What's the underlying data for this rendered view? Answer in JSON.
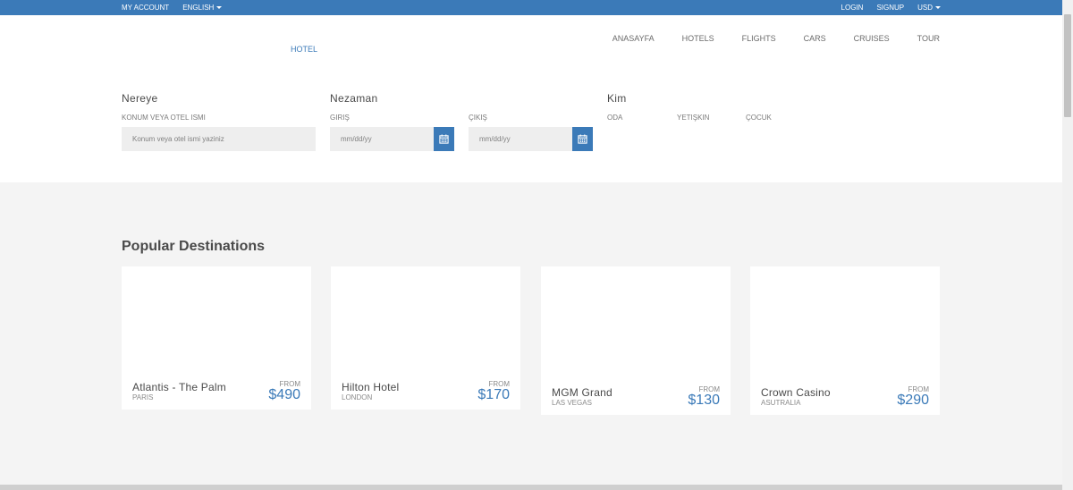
{
  "topbar": {
    "my_account": "MY ACCOUNT",
    "language": "ENGLISH",
    "login": "LOGIN",
    "signup": "SIGNUP",
    "currency": "USD"
  },
  "header": {
    "hotel_tab": "HOTEL",
    "nav": [
      "ANASAYFA",
      "HOTELS",
      "FLIGHTS",
      "CARS",
      "CRUISES",
      "TOUR"
    ]
  },
  "search": {
    "where": {
      "title": "Nereye",
      "label": "KONUM VEYA OTEL ISMI",
      "placeholder": "Konum veya otel ismi yaziniz"
    },
    "when": {
      "title": "Nezaman",
      "checkin_label": "GIRIŞ",
      "checkin_placeholder": "mm/dd/yy",
      "checkout_label": "ÇIKIŞ",
      "checkout_placeholder": "mm/dd/yy"
    },
    "who": {
      "title": "Kim",
      "room_label": "ODA",
      "adult_label": "YETIŞKIN",
      "child_label": "ÇOCUK"
    }
  },
  "destinations": {
    "title": "Popular Destinations",
    "cards": [
      {
        "name": "Atlantis - The Palm",
        "city": "PARIS",
        "from": "FROM",
        "price": "$490"
      },
      {
        "name": "Hilton Hotel",
        "city": "LONDON",
        "from": "FROM",
        "price": "$170"
      },
      {
        "name": "MGM Grand",
        "city": "LAS VEGAS",
        "from": "FROM",
        "price": "$130"
      },
      {
        "name": "Crown Casino",
        "city": "ASUTRALIA",
        "from": "FROM",
        "price": "$290"
      }
    ]
  },
  "icons": {
    "calendar": "calendar-icon",
    "caret": "caret-down-icon"
  },
  "colors": {
    "brand": "#3b7ab8",
    "background": "#f4f4f4"
  }
}
